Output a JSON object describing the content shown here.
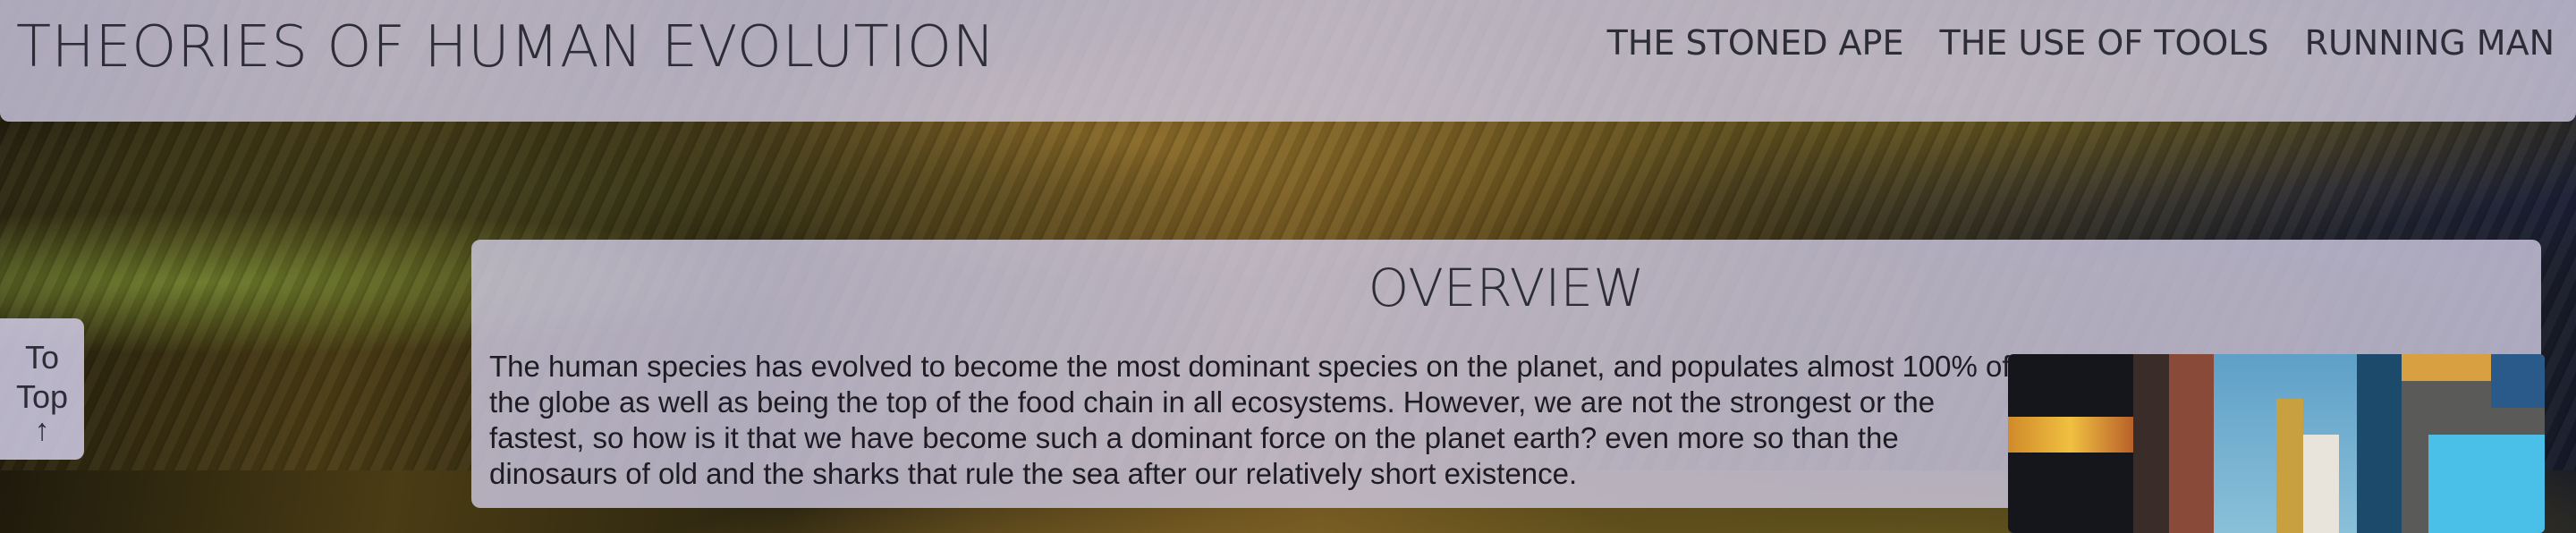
{
  "header": {
    "title": "THEORIES OF HUMAN EVOLUTION",
    "nav": [
      {
        "label": "THE STONED APE"
      },
      {
        "label": "THE USE OF TOOLS"
      },
      {
        "label": "RUNNING MAN"
      }
    ]
  },
  "main": {
    "section_title": "OVERVIEW",
    "body_text": "The human species has evolved to become the most dominant species on the planet, and populates almost 100% of the globe as well as being the top of the food chain in all ecosystems. However, we are not the strongest or the fastest, so how is it that we have become such a dominant force on the planet earth? even more so than the dinosaurs of old and the sharks that rule the sea after our relatively short existence."
  },
  "to_top": {
    "label": "To Top",
    "arrow": "↑"
  }
}
